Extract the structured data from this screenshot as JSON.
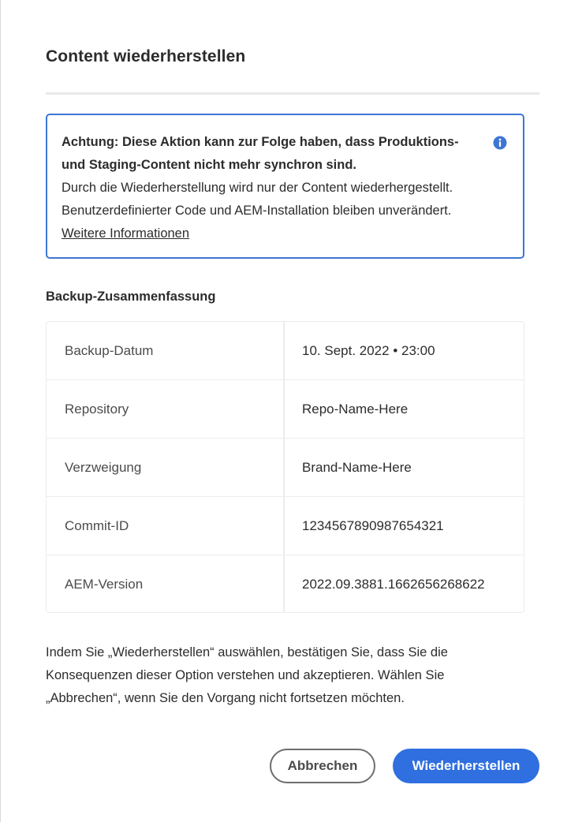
{
  "dialog": {
    "title": "Content wiederherstellen"
  },
  "alert": {
    "heading": "Achtung: Diese Aktion kann zur Folge haben, dass Produktions- und Staging-Content nicht mehr synchron sind.",
    "body": "Durch die Wiederherstellung wird nur der Content wiederhergestellt. Benutzerdefinierter Code und AEM-Installation bleiben unverändert.",
    "link": "Weitere Informationen",
    "icon": "info-icon",
    "accent_color": "#3e76d4"
  },
  "summary": {
    "title": "Backup-Zusammenfassung",
    "rows": [
      {
        "label": "Backup-Datum",
        "value": "10. Sept. 2022 • 23:00"
      },
      {
        "label": "Repository",
        "value": "Repo-Name-Here"
      },
      {
        "label": "Verzweigung",
        "value": "Brand-Name-Here"
      },
      {
        "label": "Commit-ID",
        "value": "1234567890987654321"
      },
      {
        "label": "AEM-Version",
        "value": "2022.09.3881.1662656268622"
      }
    ]
  },
  "confirm_text": "Indem Sie „Wiederherstellen“ auswählen, bestätigen Sie, dass Sie die Konsequenzen dieser Option verstehen und akzeptieren. Wählen Sie „Abbrechen“, wenn Sie den Vorgang nicht fortsetzen möchten.",
  "buttons": {
    "cancel": "Abbrechen",
    "restore": "Wiederherstellen",
    "primary_color": "#2f6fe0"
  }
}
